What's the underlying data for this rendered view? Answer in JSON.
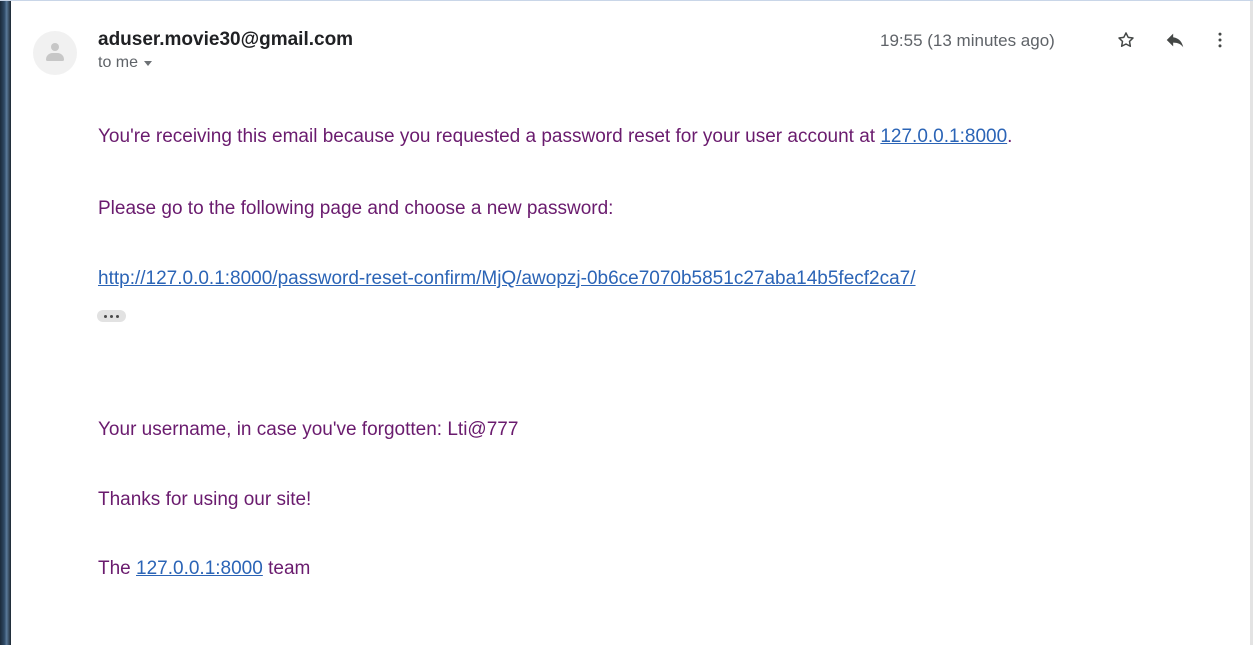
{
  "email": {
    "sender": "aduser.movie30@gmail.com",
    "recipient": "to me",
    "timestamp": "19:55 (13 minutes ago)"
  },
  "icons": {
    "avatar": "person-icon",
    "star": "star-icon",
    "reply": "reply-icon",
    "more": "more-vert-icon",
    "expand": "ellipsis-icon"
  },
  "body": {
    "intro_text": "You're receiving this email because you requested a password reset for your user account at ",
    "intro_link": "127.0.0.1:8000",
    "intro_end": ".",
    "instruction": "Please go to the following page and choose a new password:",
    "reset_link": "http://127.0.0.1:8000/password-reset-confirm/MjQ/awopzj-0b6ce7070b5851c27aba14b5fecf2ca7/",
    "username_line": "Your username, in case you've forgotten: Lti@777",
    "thanks": "Thanks for using our site!",
    "signoff_prefix": "The ",
    "signoff_link": "127.0.0.1:8000",
    "signoff_suffix": " team"
  },
  "colors": {
    "body_text": "#6a1b6e",
    "link": "#2b64b6",
    "sender": "#202124",
    "meta": "#5f6368"
  }
}
